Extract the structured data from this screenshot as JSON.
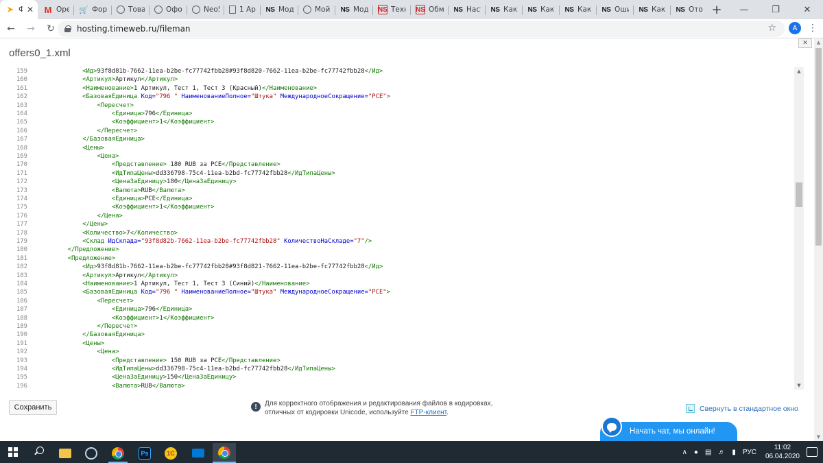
{
  "browser": {
    "tabs": [
      {
        "title": "Ф",
        "icon": "arrow-favicon-icon",
        "active": true
      },
      {
        "title": "Oper",
        "icon": "gmail-icon"
      },
      {
        "title": "Фору",
        "icon": "cart-favicon-icon"
      },
      {
        "title": "Това",
        "icon": "globe-icon"
      },
      {
        "title": "Офор",
        "icon": "globe-icon"
      },
      {
        "title": "Neo5",
        "icon": "globe-icon"
      },
      {
        "title": "1 Арт",
        "icon": "doc-icon"
      },
      {
        "title": "Моду",
        "icon": "ns-icon"
      },
      {
        "title": "Мой",
        "icon": "globe-icon"
      },
      {
        "title": "Моду",
        "icon": "ns-icon"
      },
      {
        "title": "Техни",
        "icon": "ns-red-icon"
      },
      {
        "title": "Обме",
        "icon": "ns-red-icon"
      },
      {
        "title": "Насти",
        "icon": "ns-icon"
      },
      {
        "title": "Как з",
        "icon": "ns-icon"
      },
      {
        "title": "Как с",
        "icon": "ns-icon"
      },
      {
        "title": "Как в",
        "icon": "ns-icon"
      },
      {
        "title": "Оши",
        "icon": "ns-icon"
      },
      {
        "title": "Как в",
        "icon": "ns-icon"
      },
      {
        "title": "Отоб",
        "icon": "ns-icon"
      }
    ],
    "new_tab": "+",
    "window_controls": {
      "minimize": "—",
      "maximize": "❐",
      "close": "✕"
    },
    "url": "hosting.timeweb.ru/fileman",
    "profile_initial": "A"
  },
  "page": {
    "file_title": "offers0_1.xml",
    "collapse_label": "✕",
    "save_button": "Сохранить",
    "notice_line1": "Для корректного отображения и редактирования файлов в кодировках, ",
    "notice_line2": "отличных от кодировки Unicode, используйте ",
    "notice_link": "FTP-клиент",
    "notice_end": ".",
    "minimize_link": "Свернуть в стандартное окно",
    "chat_label": "Начать чат, мы онлайн!"
  },
  "editor": {
    "first_line": 159,
    "lines": [
      [
        [
          12,
          ""
        ],
        [
          "tag",
          "<Ид>"
        ],
        [
          "txt",
          "93f8d81b-7662-11ea-b2be-fc77742fbb28#93f8d820-7662-11ea-b2be-fc77742fbb28"
        ],
        [
          "tag",
          "</Ид>"
        ]
      ],
      [
        [
          12,
          ""
        ],
        [
          "tag",
          "<Артикул>"
        ],
        [
          "txt",
          "Артикул"
        ],
        [
          "tag",
          "</Артикул>"
        ]
      ],
      [
        [
          12,
          ""
        ],
        [
          "tag",
          "<Наименование>"
        ],
        [
          "txt",
          "1 Артикул, Тест 1, Тест 3 (Красный)"
        ],
        [
          "tag",
          "</Наименование>"
        ]
      ],
      [
        [
          12,
          ""
        ],
        [
          "tag",
          "<БазоваяЕдиница "
        ],
        [
          "attr",
          "Код="
        ],
        [
          "str",
          "\"796 \""
        ],
        [
          "txt",
          " "
        ],
        [
          "attr",
          "НаименованиеПолное="
        ],
        [
          "str",
          "\"Штука\""
        ],
        [
          "txt",
          " "
        ],
        [
          "attr",
          "МеждународноеСокращение="
        ],
        [
          "str",
          "\"PCE\""
        ],
        [
          "tag",
          ">"
        ]
      ],
      [
        [
          16,
          ""
        ],
        [
          "tag",
          "<Пересчет>"
        ]
      ],
      [
        [
          20,
          ""
        ],
        [
          "tag",
          "<Единица>"
        ],
        [
          "txt",
          "796"
        ],
        [
          "tag",
          "</Единица>"
        ]
      ],
      [
        [
          20,
          ""
        ],
        [
          "tag",
          "<Коэффициент>"
        ],
        [
          "txt",
          "1"
        ],
        [
          "tag",
          "</Коэффициент>"
        ]
      ],
      [
        [
          16,
          ""
        ],
        [
          "tag",
          "</Пересчет>"
        ]
      ],
      [
        [
          12,
          ""
        ],
        [
          "tag",
          "</БазоваяЕдиница>"
        ]
      ],
      [
        [
          12,
          ""
        ],
        [
          "tag",
          "<Цены>"
        ]
      ],
      [
        [
          16,
          ""
        ],
        [
          "tag",
          "<Цена>"
        ]
      ],
      [
        [
          20,
          ""
        ],
        [
          "tag",
          "<Представление>"
        ],
        [
          "txt",
          " 180 RUB за PCE"
        ],
        [
          "tag",
          "</Представление>"
        ]
      ],
      [
        [
          20,
          ""
        ],
        [
          "tag",
          "<ИдТипаЦены>"
        ],
        [
          "txt",
          "dd336798-75c4-11ea-b2bd-fc77742fbb28"
        ],
        [
          "tag",
          "</ИдТипаЦены>"
        ]
      ],
      [
        [
          20,
          ""
        ],
        [
          "tag",
          "<ЦенаЗаЕдиницу>"
        ],
        [
          "txt",
          "180"
        ],
        [
          "tag",
          "</ЦенаЗаЕдиницу>"
        ]
      ],
      [
        [
          20,
          ""
        ],
        [
          "tag",
          "<Валюта>"
        ],
        [
          "txt",
          "RUB"
        ],
        [
          "tag",
          "</Валюта>"
        ]
      ],
      [
        [
          20,
          ""
        ],
        [
          "tag",
          "<Единица>"
        ],
        [
          "txt",
          "PCE"
        ],
        [
          "tag",
          "</Единица>"
        ]
      ],
      [
        [
          20,
          ""
        ],
        [
          "tag",
          "<Коэффициент>"
        ],
        [
          "txt",
          "1"
        ],
        [
          "tag",
          "</Коэффициент>"
        ]
      ],
      [
        [
          16,
          ""
        ],
        [
          "tag",
          "</Цена>"
        ]
      ],
      [
        [
          12,
          ""
        ],
        [
          "tag",
          "</Цены>"
        ]
      ],
      [
        [
          12,
          ""
        ],
        [
          "tag",
          "<Количество>"
        ],
        [
          "txt",
          "7"
        ],
        [
          "tag",
          "</Количество>"
        ]
      ],
      [
        [
          12,
          ""
        ],
        [
          "tag",
          "<Склад "
        ],
        [
          "attr",
          "ИдСклада="
        ],
        [
          "str",
          "\"93f8d82b-7662-11ea-b2be-fc77742fbb28\""
        ],
        [
          "txt",
          " "
        ],
        [
          "attr",
          "КоличествоНаСкладе="
        ],
        [
          "str",
          "\"7\""
        ],
        [
          "tag",
          "/>"
        ]
      ],
      [
        [
          8,
          ""
        ],
        [
          "tag",
          "</Предложение>"
        ]
      ],
      [
        [
          8,
          ""
        ],
        [
          "tag",
          "<Предложение>"
        ]
      ],
      [
        [
          12,
          ""
        ],
        [
          "tag",
          "<Ид>"
        ],
        [
          "txt",
          "93f8d81b-7662-11ea-b2be-fc77742fbb28#93f8d821-7662-11ea-b2be-fc77742fbb28"
        ],
        [
          "tag",
          "</Ид>"
        ]
      ],
      [
        [
          12,
          ""
        ],
        [
          "tag",
          "<Артикул>"
        ],
        [
          "txt",
          "Артикул"
        ],
        [
          "tag",
          "</Артикул>"
        ]
      ],
      [
        [
          12,
          ""
        ],
        [
          "tag",
          "<Наименование>"
        ],
        [
          "txt",
          "1 Артикул, Тест 1, Тест 3 (Синий)"
        ],
        [
          "tag",
          "</Наименование>"
        ]
      ],
      [
        [
          12,
          ""
        ],
        [
          "tag",
          "<БазоваяЕдиница "
        ],
        [
          "attr",
          "Код="
        ],
        [
          "str",
          "\"796 \""
        ],
        [
          "txt",
          " "
        ],
        [
          "attr",
          "НаименованиеПолное="
        ],
        [
          "str",
          "\"Штука\""
        ],
        [
          "txt",
          " "
        ],
        [
          "attr",
          "МеждународноеСокращение="
        ],
        [
          "str",
          "\"PCE\""
        ],
        [
          "tag",
          ">"
        ]
      ],
      [
        [
          16,
          ""
        ],
        [
          "tag",
          "<Пересчет>"
        ]
      ],
      [
        [
          20,
          ""
        ],
        [
          "tag",
          "<Единица>"
        ],
        [
          "txt",
          "796"
        ],
        [
          "tag",
          "</Единица>"
        ]
      ],
      [
        [
          20,
          ""
        ],
        [
          "tag",
          "<Коэффициент>"
        ],
        [
          "txt",
          "1"
        ],
        [
          "tag",
          "</Коэффициент>"
        ]
      ],
      [
        [
          16,
          ""
        ],
        [
          "tag",
          "</Пересчет>"
        ]
      ],
      [
        [
          12,
          ""
        ],
        [
          "tag",
          "</БазоваяЕдиница>"
        ]
      ],
      [
        [
          12,
          ""
        ],
        [
          "tag",
          "<Цены>"
        ]
      ],
      [
        [
          16,
          ""
        ],
        [
          "tag",
          "<Цена>"
        ]
      ],
      [
        [
          20,
          ""
        ],
        [
          "tag",
          "<Представление>"
        ],
        [
          "txt",
          " 150 RUB за PCE"
        ],
        [
          "tag",
          "</Представление>"
        ]
      ],
      [
        [
          20,
          ""
        ],
        [
          "tag",
          "<ИдТипаЦены>"
        ],
        [
          "txt",
          "dd336798-75c4-11ea-b2bd-fc77742fbb28"
        ],
        [
          "tag",
          "</ИдТипаЦены>"
        ]
      ],
      [
        [
          20,
          ""
        ],
        [
          "tag",
          "<ЦенаЗаЕдиницу>"
        ],
        [
          "txt",
          "150"
        ],
        [
          "tag",
          "</ЦенаЗаЕдиницу>"
        ]
      ],
      [
        [
          20,
          ""
        ],
        [
          "tag",
          "<Валюта>"
        ],
        [
          "txt",
          "RUB"
        ],
        [
          "tag",
          "</Валюта>"
        ]
      ]
    ]
  },
  "taskbar": {
    "apps": [
      {
        "name": "file-explorer",
        "icon": "folder-icon"
      },
      {
        "name": "steam",
        "icon": "steam-icon"
      },
      {
        "name": "chrome",
        "icon": "chrome-icon"
      },
      {
        "name": "photoshop",
        "icon": "photoshop-icon",
        "label": "Ps"
      },
      {
        "name": "1c",
        "icon": "1c-icon",
        "label": "1С"
      },
      {
        "name": "mail",
        "icon": "mail-icon"
      },
      {
        "name": "chrome-active",
        "icon": "chrome-icon"
      }
    ],
    "tray_chevron": "∧",
    "language": "РУС",
    "time": "11:02",
    "date": "06.04.2020"
  }
}
